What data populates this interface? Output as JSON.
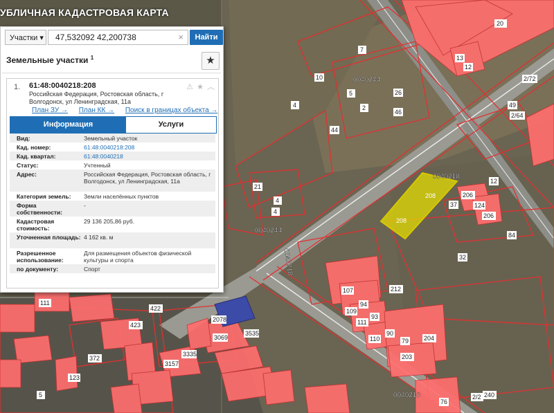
{
  "app": {
    "title": "УБЛИЧНАЯ КАДАСТРОВАЯ КАРТА"
  },
  "search": {
    "type_label": "Участки",
    "type_arrow": "▾",
    "value": "47,532092 42,200738",
    "clear": "×",
    "button_label": "Найти"
  },
  "section": {
    "title": "Земельные участки",
    "count": "1"
  },
  "parcel": {
    "index": "1.",
    "number": "61:48:0040218:208",
    "address_short": "Российская Федерация, Ростовская область, г Волгодонск, ул Ленинградская, 11а",
    "links": [
      "План ЗУ →",
      "План КК →",
      "Поиск в границах объекта →"
    ],
    "tools": "⚠ ★ ︿"
  },
  "tabs": [
    "Информация",
    "Услуги"
  ],
  "info_rows": [
    {
      "label": "Вид:",
      "value": "Земельный участок",
      "link": false,
      "h": 13
    },
    {
      "label": "Кад. номер:",
      "value": "61:48:0040218:208",
      "link": true,
      "h": 13
    },
    {
      "label": "Кад. квартал:",
      "value": "61:48:0040218",
      "link": true,
      "h": 13
    },
    {
      "label": "Статус:",
      "value": "Учтенный",
      "link": false,
      "h": 13
    },
    {
      "label": "Адрес:",
      "value": "Российская Федерация, Ростовская область, г Волгодонск, ул Ленинградская, 11а",
      "link": false,
      "h": 32
    },
    {
      "label": "Категория земель:",
      "value": "Земли населённых пунктов",
      "link": false,
      "h": 13
    },
    {
      "label": "Форма собственности:",
      "value": "-",
      "link": false,
      "h": 23
    },
    {
      "label": "Кадастровая стоимость:",
      "value": "29 136 205,86 руб.",
      "link": false,
      "h": 23
    },
    {
      "label": "Уточненная площадь:",
      "value": "4 162 кв. м",
      "link": false,
      "h": 23
    },
    {
      "label": "Разрешенное использование:",
      "value": "Для размещения объектов физической культуры и спорта",
      "link": false,
      "h": 23
    },
    {
      "label": "по документу:",
      "value": "Спорт",
      "link": false,
      "h": 13
    }
  ],
  "map_labels": {
    "quarters": [
      "0040244",
      "0040218",
      "0040244",
      "0040218",
      "0040218"
    ],
    "parcels": [
      "20",
      "13",
      "12",
      "7",
      "10",
      "5",
      "2",
      "46",
      "26",
      "49",
      "2/64",
      "2/72",
      "44",
      "4",
      "21",
      "4",
      "208",
      "208",
      "206",
      "124",
      "206",
      "12",
      "37",
      "32",
      "32",
      "84",
      "107",
      "109",
      "94",
      "111",
      "93",
      "110",
      "90",
      "212",
      "79",
      "204",
      "203",
      "422",
      "423",
      "2078",
      "3069",
      "3535",
      "3157",
      "3335",
      "372",
      "111",
      "123",
      "5",
      "76",
      "240",
      "2/2"
    ]
  },
  "colors": {
    "accent": "#1f6eb5",
    "highlight": "#e8e000",
    "building": "#ff6e6e",
    "boundary": "#e23030"
  }
}
